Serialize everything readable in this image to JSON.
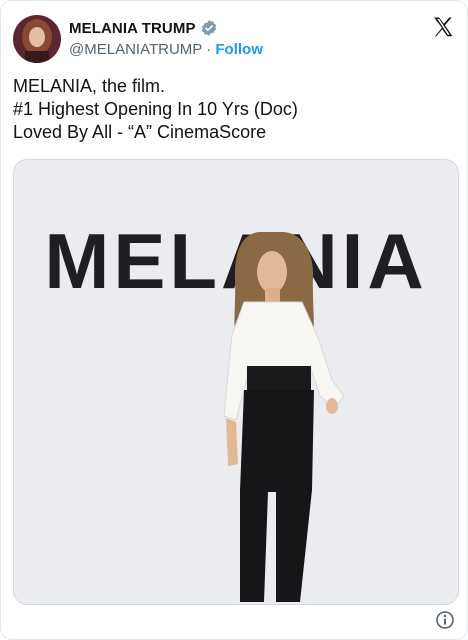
{
  "author": {
    "display_name": "MELANIA TRUMP",
    "handle": "@MELANIATRUMP",
    "separator": "·",
    "follow_label": "Follow"
  },
  "post": {
    "lines": [
      "MELANIA, the film.",
      "#1 Highest Opening In 10 Yrs (Doc)",
      "Loved By All - “A” CinemaScore"
    ]
  },
  "media": {
    "backdrop_text": "MELANIA"
  },
  "icons": {
    "verified": "verified-badge-icon",
    "platform": "x-logo-icon",
    "info": "info-icon"
  },
  "colors": {
    "accent": "#1d9bf0",
    "text": "#0f1419",
    "muted": "#536471"
  }
}
